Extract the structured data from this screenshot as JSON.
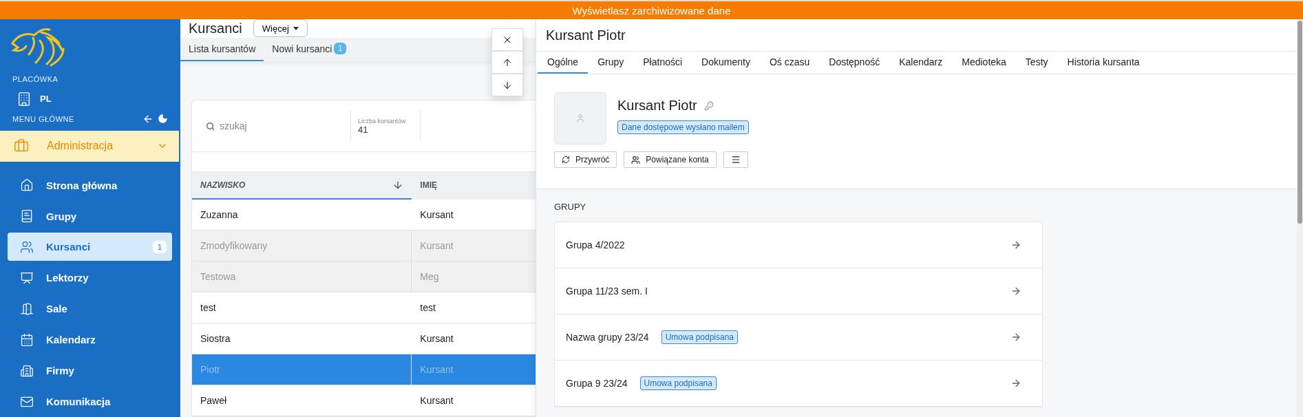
{
  "banner": "Wyświetlasz zarchiwizowane dane",
  "sidebar": {
    "branch_label": "PLACÓWKA",
    "branch": "PL",
    "menu_label": "MENU GŁÓWNE",
    "section": {
      "label": "Administracja",
      "expanded": true
    },
    "items": [
      {
        "label": "Strona główna",
        "kind": "home",
        "selected": false
      },
      {
        "label": "Grupy",
        "kind": "book",
        "selected": false
      },
      {
        "label": "Kursanci",
        "kind": "users",
        "selected": true,
        "badge": "1"
      },
      {
        "label": "Lektorzy",
        "kind": "teacher",
        "selected": false
      },
      {
        "label": "Sale",
        "kind": "door",
        "selected": false
      },
      {
        "label": "Kalendarz",
        "kind": "calendar",
        "selected": false
      },
      {
        "label": "Firmy",
        "kind": "building",
        "selected": false
      },
      {
        "label": "Komunikacja",
        "kind": "mail",
        "selected": false
      }
    ]
  },
  "list": {
    "title": "Kursanci",
    "more_button": "Więcej",
    "tabs": [
      {
        "label": "Lista kursantów",
        "selected": true
      },
      {
        "label": "Nowi kursanci",
        "selected": false,
        "badge": "1"
      }
    ],
    "search": {
      "placeholder": "szukaj"
    },
    "count_label": "Liczba kursantów",
    "count": "41",
    "columns": [
      {
        "label": "NAZWISKO",
        "sorted": true
      },
      {
        "label": "IMIĘ",
        "sorted": false
      }
    ],
    "rows": [
      {
        "cells": [
          "Zuzanna",
          "Kursant"
        ],
        "archived": false,
        "selected": false
      },
      {
        "cells": [
          "Zmodyfikowany",
          "Kursant"
        ],
        "archived": true,
        "selected": false
      },
      {
        "cells": [
          "Testowa",
          "Meg"
        ],
        "archived": true,
        "selected": false
      },
      {
        "cells": [
          "test",
          "test"
        ],
        "archived": false,
        "selected": false
      },
      {
        "cells": [
          "Siostra",
          "Kursant"
        ],
        "archived": false,
        "selected": false
      },
      {
        "cells": [
          "Piotr",
          "Kursant"
        ],
        "archived": false,
        "selected": true
      },
      {
        "cells": [
          "Paweł",
          "Kursant"
        ],
        "archived": false,
        "selected": false
      }
    ]
  },
  "detail": {
    "title": "Kursant Piotr",
    "tabs": [
      {
        "label": "Ogólne",
        "selected": true
      },
      {
        "label": "Grupy",
        "selected": false
      },
      {
        "label": "Płatności",
        "selected": false
      },
      {
        "label": "Dokumenty",
        "selected": false
      },
      {
        "label": "Oś czasu",
        "selected": false
      },
      {
        "label": "Dostępność",
        "selected": false
      },
      {
        "label": "Kalendarz",
        "selected": false
      },
      {
        "label": "Medioteka",
        "selected": false
      },
      {
        "label": "Testy",
        "selected": false
      },
      {
        "label": "Historia kursanta",
        "selected": false
      }
    ],
    "name": "Kursant Piotr",
    "status_tag": "Dane dostępowe wysłano mailem",
    "buttons": [
      {
        "kind": "restore",
        "label": "Przywróć"
      },
      {
        "kind": "accounts",
        "label": "Powiązane konta"
      },
      {
        "kind": "menu"
      }
    ],
    "section_title": "GRUPY",
    "groups": [
      {
        "name": "Grupa 4/2022"
      },
      {
        "name": "Grupa 11/23 sem. I"
      },
      {
        "name": "Nazwa grupy 23/24",
        "tag": "Umowa podpisana"
      },
      {
        "name": "Grupa 9 23/24",
        "tag": "Umowa podpisana"
      }
    ]
  }
}
